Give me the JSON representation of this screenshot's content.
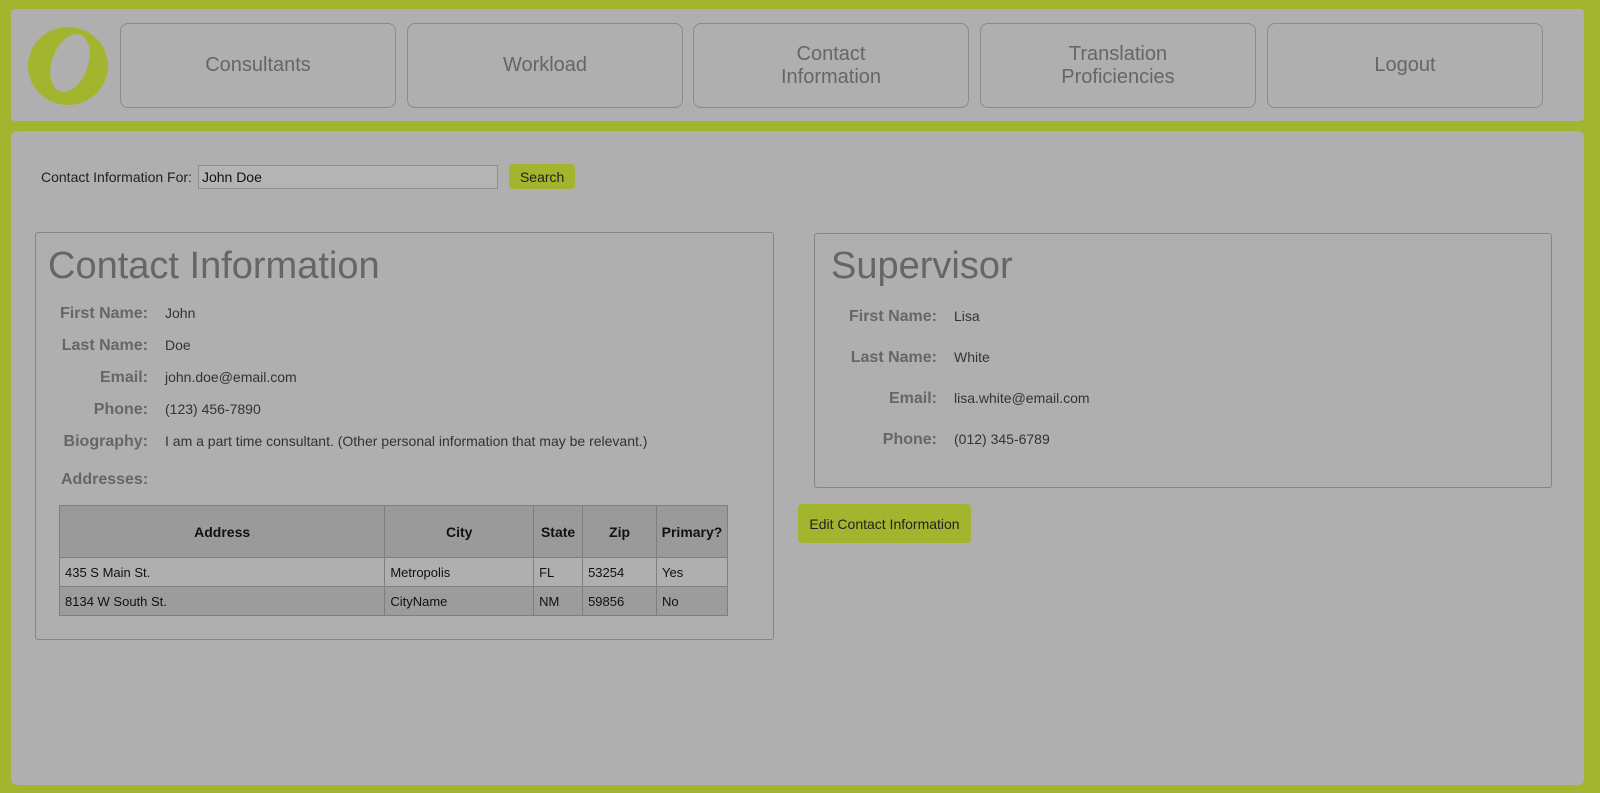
{
  "nav": {
    "items": [
      {
        "label": "Consultants"
      },
      {
        "label": "Workload"
      },
      {
        "label": "Contact\nInformation"
      },
      {
        "label": "Translation\nProficiencies"
      },
      {
        "label": "Logout"
      }
    ]
  },
  "search": {
    "label": "Contact Information For:",
    "value": "John Doe",
    "button": "Search"
  },
  "contact": {
    "title": "Contact Information",
    "fields": [
      {
        "label": "First Name:",
        "value": "John"
      },
      {
        "label": "Last Name:",
        "value": "Doe"
      },
      {
        "label": "Email:",
        "value": "john.doe@email.com"
      },
      {
        "label": "Phone:",
        "value": "(123) 456-7890"
      },
      {
        "label": "Biography:",
        "value": "I am a part time consultant. (Other personal information that may be relevant.)"
      }
    ],
    "addresses_label": "Addresses:",
    "table": {
      "headers": [
        "Address",
        "City",
        "State",
        "Zip",
        "Primary?"
      ],
      "rows": [
        [
          "435 S Main St.",
          "Metropolis",
          "FL",
          "53254",
          "Yes"
        ],
        [
          "8134 W South St.",
          "CityName",
          "NM",
          "59856",
          "No"
        ]
      ]
    }
  },
  "supervisor": {
    "title": "Supervisor",
    "fields": [
      {
        "label": "First Name:",
        "value": "Lisa"
      },
      {
        "label": "Last Name:",
        "value": "White"
      },
      {
        "label": "Email:",
        "value": "lisa.white@email.com"
      },
      {
        "label": "Phone:",
        "value": "(012) 345-6789"
      }
    ]
  },
  "actions": {
    "edit_button": "Edit Contact Information"
  },
  "colors": {
    "accent": "#a3b52e",
    "panel_bg": "#afafaf"
  },
  "icons": {
    "logo": "brand-logo-icon"
  }
}
